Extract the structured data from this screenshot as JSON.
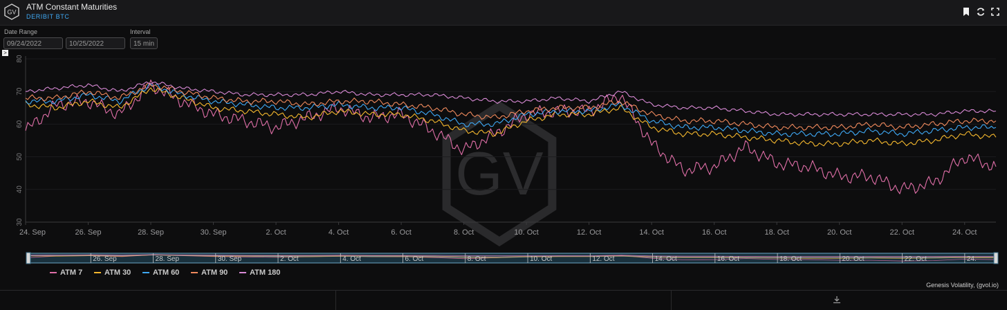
{
  "header": {
    "title": "ATM Constant Maturities",
    "subtitle": "DERIBIT BTC",
    "logo_text": "GV"
  },
  "controls": {
    "date_range_label": "Date Range",
    "start_date": "09/24/2022",
    "end_date": "10/25/2022",
    "interval_label": "Interval",
    "interval_value": "15 min"
  },
  "watermark": "GV",
  "credit": "Genesis Volatility, (gvol.io)",
  "colors": {
    "ATM 7": "#e06fa8",
    "ATM 30": "#f5b82e",
    "ATM 60": "#3fa9f5",
    "ATM 90": "#f08a5d",
    "ATM 180": "#d98ad6"
  },
  "icons": [
    "bookmark-icon",
    "refresh-icon",
    "download-icon",
    "expand-icon"
  ],
  "chart_data": {
    "type": "line",
    "ylim": [
      30,
      80
    ],
    "yticks": [
      30,
      40,
      50,
      60,
      70,
      80
    ],
    "xlim": [
      "2022-09-24",
      "2022-10-25"
    ],
    "xticks": [
      "24. Sep",
      "26. Sep",
      "28. Sep",
      "30. Sep",
      "2. Oct",
      "4. Oct",
      "6. Oct",
      "8. Oct",
      "10. Oct",
      "12. Oct",
      "14. Oct",
      "16. Oct",
      "18. Oct",
      "20. Oct",
      "22. Oct",
      "24. Oct"
    ],
    "navigator_ticks": [
      "26. Sep",
      "28. Sep",
      "30. Sep",
      "2. Oct",
      "4. Oct",
      "6. Oct",
      "8. Oct",
      "10. Oct",
      "12. Oct",
      "14. Oct",
      "16. Oct",
      "18. Oct",
      "20. Oct",
      "22. Oct",
      "24."
    ],
    "x": [
      "2022-09-24",
      "2022-09-25",
      "2022-09-26",
      "2022-09-27",
      "2022-09-28",
      "2022-09-29",
      "2022-09-30",
      "2022-10-01",
      "2022-10-02",
      "2022-10-03",
      "2022-10-04",
      "2022-10-05",
      "2022-10-06",
      "2022-10-07",
      "2022-10-08",
      "2022-10-09",
      "2022-10-10",
      "2022-10-11",
      "2022-10-12",
      "2022-10-13",
      "2022-10-14",
      "2022-10-15",
      "2022-10-16",
      "2022-10-17",
      "2022-10-18",
      "2022-10-19",
      "2022-10-20",
      "2022-10-21",
      "2022-10-22",
      "2022-10-23",
      "2022-10-24",
      "2022-10-25"
    ],
    "series": [
      {
        "name": "ATM 7",
        "values": [
          58,
          66,
          67,
          63,
          72,
          67,
          63,
          61,
          59,
          62,
          65,
          62,
          63,
          58,
          52,
          57,
          63,
          64,
          64,
          69,
          54,
          46,
          47,
          53,
          48,
          47,
          44,
          44,
          40,
          42,
          50,
          47
        ]
      },
      {
        "name": "ATM 30",
        "values": [
          66,
          65,
          67,
          65,
          71,
          68,
          65,
          64,
          63,
          62,
          64,
          63,
          63,
          61,
          58,
          57,
          61,
          63,
          63,
          65,
          59,
          57,
          57,
          56,
          55,
          54,
          54,
          55,
          54,
          55,
          57,
          56
        ]
      },
      {
        "name": "ATM 60",
        "values": [
          67,
          67,
          69,
          67,
          72,
          69,
          67,
          66,
          65,
          65,
          66,
          65,
          65,
          63,
          60,
          60,
          63,
          64,
          64,
          66,
          61,
          59,
          59,
          58,
          57,
          57,
          57,
          58,
          57,
          58,
          59,
          59
        ]
      },
      {
        "name": "ATM 90",
        "values": [
          68,
          68,
          70,
          68,
          72,
          70,
          68,
          67,
          67,
          66,
          67,
          67,
          66,
          65,
          63,
          62,
          64,
          65,
          65,
          67,
          63,
          61,
          61,
          60,
          59,
          59,
          59,
          60,
          59,
          60,
          61,
          61
        ]
      },
      {
        "name": "ATM 180",
        "values": [
          70,
          71,
          72,
          70,
          73,
          71,
          70,
          69,
          69,
          69,
          70,
          69,
          69,
          69,
          68,
          67,
          67,
          68,
          67,
          70,
          66,
          65,
          65,
          64,
          63,
          63,
          63,
          63,
          63,
          63,
          64,
          64
        ]
      }
    ]
  }
}
